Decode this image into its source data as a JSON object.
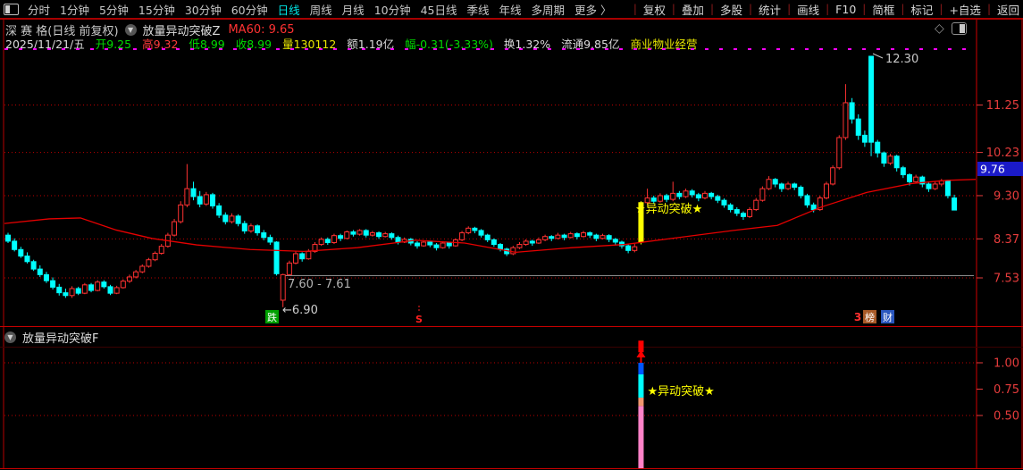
{
  "colors": {
    "background": "#000000",
    "accent_red": "#C80000",
    "menu_text": "#C8C8C8",
    "active_tab": "#00E5E5",
    "candle_up": "#FF3232",
    "candle_down": "#00FFFF",
    "highlight_candle": "#FFFF00",
    "ma60_line": "#E60000",
    "grid_dotted": "#BE0000",
    "axis_text": "#E63C3C",
    "price_box_bg": "#1A1AC8",
    "magenta_line": "#FF00FF",
    "gap_line": "#8C8C8C",
    "fall_badge_bg": "#00A000",
    "rank_badge_bg": "#A85A28",
    "finance_badge_bg": "#2B57BE",
    "bar_pink": "#FF82C8",
    "bar_salmon": "#F0966E",
    "bar_cyan": "#00FFFF",
    "bar_blue": "#0055FF",
    "bar_red": "#FF0000",
    "annotation_gray": "#C8C8C8",
    "yellow_text": "#FFFF00"
  },
  "menu_bar": {
    "left_items": [
      "分时",
      "1分钟",
      "5分钟",
      "15分钟",
      "30分钟",
      "60分钟",
      "日线",
      "周线",
      "月线",
      "10分钟",
      "45日线",
      "季线",
      "年线",
      "多周期",
      "更多 〉"
    ],
    "active_item": "日线",
    "right_items": [
      "复权",
      "叠加",
      "多股",
      "统计",
      "画线",
      "F10",
      "简框",
      "标记",
      "+自选",
      "返回"
    ]
  },
  "title_row": {
    "stock_title": "深 赛 格(日线 前复权)",
    "chevron_glyph": "▼",
    "indicator_name": "放量异动突破Z",
    "ma_label": "MA60: 9.65",
    "diamond_glyph": "◇"
  },
  "info_row": {
    "date": "2025/11/21/五",
    "open": "开9.25",
    "high": "高9.32",
    "low": "低8.99",
    "close": "收8.99",
    "volume": "量130112",
    "amount": "额1.19亿",
    "change": "幅-0.31(-3.33%)",
    "turnover": "换1.32%",
    "float_shares": "流通9.85亿",
    "industry": "商业物业经营"
  },
  "sub_panel": {
    "label": "放量异动突破F"
  },
  "chart_data": [
    {
      "type": "candlestick",
      "title": "深赛格 日线 前复权",
      "y_ticks": [
        "11.25",
        "10.23",
        "9.30",
        "8.37",
        "7.53"
      ],
      "price_box": "9.76",
      "grid": "dotted-red-horizontal",
      "legend_position": "none",
      "annotations": {
        "peak": "12.30",
        "gap_range": "7.60 - 7.61",
        "low": "←6.90",
        "fall_badge": "跌",
        "sell_marker": "S",
        "rank_num": "3",
        "rank_badge": "榜",
        "finance_badge": "财",
        "breakout": "★异动突破★"
      },
      "ma60": {
        "name": "MA60",
        "value": 9.65,
        "points": [
          [
            5,
            8.7
          ],
          [
            55,
            8.8
          ],
          [
            90,
            8.82
          ],
          [
            130,
            8.56
          ],
          [
            170,
            8.38
          ],
          [
            220,
            8.24
          ],
          [
            280,
            8.14
          ],
          [
            340,
            8.1
          ],
          [
            400,
            8.18
          ],
          [
            465,
            8.34
          ],
          [
            520,
            8.28
          ],
          [
            577,
            8.08
          ],
          [
            640,
            8.18
          ],
          [
            700,
            8.25
          ],
          [
            760,
            8.4
          ],
          [
            820,
            8.55
          ],
          [
            870,
            8.66
          ],
          [
            920,
            9.06
          ],
          [
            970,
            9.37
          ],
          [
            1020,
            9.56
          ],
          [
            1060,
            9.63
          ],
          [
            1092,
            9.65
          ]
        ]
      },
      "highlight_index": 99,
      "spike_index": 135,
      "candles": [
        [
          8.45,
          8.5,
          8.28,
          8.32
        ],
        [
          8.32,
          8.38,
          8.1,
          8.14
        ],
        [
          8.14,
          8.2,
          7.96,
          8.0
        ],
        [
          8.0,
          8.08,
          7.84,
          7.88
        ],
        [
          7.88,
          7.92,
          7.68,
          7.72
        ],
        [
          7.72,
          7.8,
          7.55,
          7.6
        ],
        [
          7.6,
          7.66,
          7.42,
          7.47
        ],
        [
          7.47,
          7.54,
          7.28,
          7.33
        ],
        [
          7.33,
          7.4,
          7.15,
          7.21
        ],
        [
          7.21,
          7.3,
          7.1,
          7.15
        ],
        [
          7.15,
          7.35,
          7.1,
          7.3
        ],
        [
          7.3,
          7.34,
          7.16,
          7.2
        ],
        [
          7.2,
          7.42,
          7.18,
          7.38
        ],
        [
          7.38,
          7.42,
          7.22,
          7.26
        ],
        [
          7.26,
          7.48,
          7.24,
          7.44
        ],
        [
          7.44,
          7.48,
          7.3,
          7.34
        ],
        [
          7.34,
          7.38,
          7.16,
          7.2
        ],
        [
          7.2,
          7.36,
          7.18,
          7.32
        ],
        [
          7.32,
          7.5,
          7.3,
          7.46
        ],
        [
          7.46,
          7.6,
          7.42,
          7.55
        ],
        [
          7.55,
          7.7,
          7.52,
          7.66
        ],
        [
          7.66,
          7.82,
          7.63,
          7.78
        ],
        [
          7.78,
          7.96,
          7.75,
          7.92
        ],
        [
          7.92,
          8.1,
          7.89,
          8.06
        ],
        [
          8.06,
          8.26,
          8.03,
          8.21
        ],
        [
          8.21,
          8.5,
          8.18,
          8.45
        ],
        [
          8.45,
          8.8,
          8.42,
          8.74
        ],
        [
          8.74,
          9.18,
          8.7,
          9.1
        ],
        [
          9.1,
          9.98,
          9.05,
          9.45
        ],
        [
          9.45,
          9.6,
          9.2,
          9.28
        ],
        [
          9.28,
          9.4,
          9.05,
          9.12
        ],
        [
          9.12,
          9.38,
          9.08,
          9.32
        ],
        [
          9.32,
          9.36,
          9.02,
          9.08
        ],
        [
          9.08,
          9.14,
          8.82,
          8.88
        ],
        [
          8.88,
          8.94,
          8.68,
          8.74
        ],
        [
          8.74,
          8.92,
          8.7,
          8.86
        ],
        [
          8.86,
          8.9,
          8.64,
          8.7
        ],
        [
          8.7,
          8.76,
          8.48,
          8.54
        ],
        [
          8.54,
          8.7,
          8.5,
          8.65
        ],
        [
          8.65,
          8.68,
          8.44,
          8.5
        ],
        [
          8.5,
          8.56,
          8.34,
          8.4
        ],
        [
          8.4,
          8.46,
          8.24,
          8.3
        ],
        [
          8.3,
          8.32,
          7.58,
          7.62
        ],
        [
          7.05,
          7.62,
          6.9,
          7.6
        ],
        [
          7.6,
          7.9,
          7.58,
          7.85
        ],
        [
          7.85,
          8.1,
          7.82,
          8.05
        ],
        [
          8.05,
          8.08,
          7.88,
          7.94
        ],
        [
          7.94,
          8.15,
          7.92,
          8.1
        ],
        [
          8.1,
          8.3,
          8.07,
          8.25
        ],
        [
          8.25,
          8.4,
          8.22,
          8.36
        ],
        [
          8.36,
          8.4,
          8.24,
          8.29
        ],
        [
          8.29,
          8.48,
          8.26,
          8.44
        ],
        [
          8.44,
          8.48,
          8.32,
          8.38
        ],
        [
          8.38,
          8.55,
          8.36,
          8.52
        ],
        [
          8.52,
          8.56,
          8.42,
          8.47
        ],
        [
          8.47,
          8.58,
          8.44,
          8.55
        ],
        [
          8.55,
          8.58,
          8.4,
          8.45
        ],
        [
          8.45,
          8.54,
          8.42,
          8.5
        ],
        [
          8.5,
          8.53,
          8.37,
          8.42
        ],
        [
          8.42,
          8.52,
          8.4,
          8.48
        ],
        [
          8.48,
          8.51,
          8.35,
          8.4
        ],
        [
          8.4,
          8.44,
          8.25,
          8.3
        ],
        [
          8.3,
          8.4,
          8.28,
          8.36
        ],
        [
          8.36,
          8.39,
          8.23,
          8.28
        ],
        [
          8.28,
          8.32,
          8.16,
          8.22
        ],
        [
          8.22,
          8.34,
          8.2,
          8.3
        ],
        [
          8.3,
          8.33,
          8.19,
          8.24
        ],
        [
          8.24,
          8.28,
          8.12,
          8.18
        ],
        [
          8.18,
          8.32,
          8.16,
          8.28
        ],
        [
          8.28,
          8.31,
          8.16,
          8.22
        ],
        [
          8.22,
          8.38,
          8.2,
          8.35
        ],
        [
          8.35,
          8.54,
          8.32,
          8.5
        ],
        [
          8.5,
          8.64,
          8.47,
          8.6
        ],
        [
          8.6,
          8.63,
          8.49,
          8.55
        ],
        [
          8.55,
          8.58,
          8.4,
          8.45
        ],
        [
          8.45,
          8.48,
          8.3,
          8.35
        ],
        [
          8.35,
          8.38,
          8.2,
          8.25
        ],
        [
          8.25,
          8.28,
          8.1,
          8.15
        ],
        [
          8.15,
          8.18,
          8.0,
          8.05
        ],
        [
          8.05,
          8.22,
          8.02,
          8.18
        ],
        [
          8.18,
          8.3,
          8.15,
          8.25
        ],
        [
          8.25,
          8.36,
          8.22,
          8.32
        ],
        [
          8.32,
          8.35,
          8.22,
          8.28
        ],
        [
          8.28,
          8.4,
          8.26,
          8.35
        ],
        [
          8.35,
          8.46,
          8.32,
          8.42
        ],
        [
          8.42,
          8.45,
          8.32,
          8.38
        ],
        [
          8.38,
          8.5,
          8.36,
          8.45
        ],
        [
          8.45,
          8.48,
          8.34,
          8.4
        ],
        [
          8.4,
          8.52,
          8.38,
          8.48
        ],
        [
          8.48,
          8.51,
          8.36,
          8.42
        ],
        [
          8.42,
          8.54,
          8.4,
          8.5
        ],
        [
          8.5,
          8.53,
          8.39,
          8.45
        ],
        [
          8.45,
          8.48,
          8.32,
          8.38
        ],
        [
          8.38,
          8.48,
          8.36,
          8.44
        ],
        [
          8.44,
          8.47,
          8.3,
          8.36
        ],
        [
          8.36,
          8.39,
          8.24,
          8.3
        ],
        [
          8.3,
          8.33,
          8.16,
          8.22
        ],
        [
          8.22,
          8.25,
          8.06,
          8.12
        ],
        [
          8.12,
          8.26,
          8.08,
          8.2
        ],
        [
          8.3,
          9.18,
          8.25,
          9.15
        ],
        [
          9.15,
          9.45,
          9.1,
          9.25
        ],
        [
          9.25,
          9.3,
          9.12,
          9.18
        ],
        [
          9.18,
          9.35,
          9.15,
          9.3
        ],
        [
          9.3,
          9.34,
          9.16,
          9.22
        ],
        [
          9.22,
          9.6,
          9.18,
          9.35
        ],
        [
          9.35,
          9.4,
          9.22,
          9.28
        ],
        [
          9.28,
          9.45,
          9.25,
          9.4
        ],
        [
          9.4,
          9.44,
          9.26,
          9.32
        ],
        [
          9.32,
          9.36,
          9.18,
          9.25
        ],
        [
          9.25,
          9.4,
          9.22,
          9.35
        ],
        [
          9.35,
          9.38,
          9.22,
          9.28
        ],
        [
          9.28,
          9.32,
          9.14,
          9.2
        ],
        [
          9.2,
          9.24,
          9.04,
          9.1
        ],
        [
          9.1,
          9.14,
          8.94,
          9.0
        ],
        [
          9.0,
          9.05,
          8.86,
          8.92
        ],
        [
          8.92,
          8.96,
          8.78,
          8.85
        ],
        [
          8.85,
          9.05,
          8.82,
          9.0
        ],
        [
          9.0,
          9.25,
          8.97,
          9.2
        ],
        [
          9.2,
          9.5,
          9.17,
          9.45
        ],
        [
          9.45,
          9.72,
          9.42,
          9.65
        ],
        [
          9.65,
          9.68,
          9.48,
          9.55
        ],
        [
          9.55,
          9.58,
          9.38,
          9.45
        ],
        [
          9.45,
          9.6,
          9.42,
          9.55
        ],
        [
          9.55,
          9.58,
          9.42,
          9.48
        ],
        [
          9.48,
          9.52,
          9.24,
          9.3
        ],
        [
          9.3,
          9.34,
          9.04,
          9.1
        ],
        [
          9.1,
          9.15,
          8.94,
          9.0
        ],
        [
          9.0,
          9.3,
          8.97,
          9.25
        ],
        [
          9.25,
          9.6,
          9.22,
          9.55
        ],
        [
          9.55,
          9.95,
          9.52,
          9.9
        ],
        [
          9.9,
          10.6,
          9.86,
          10.55
        ],
        [
          10.55,
          11.7,
          10.5,
          11.3
        ],
        [
          11.3,
          11.4,
          10.85,
          10.95
        ],
        [
          10.95,
          11.05,
          10.5,
          10.6
        ],
        [
          10.6,
          10.7,
          10.35,
          10.45
        ],
        [
          12.3,
          12.3,
          10.15,
          10.45
        ],
        [
          10.45,
          10.5,
          10.12,
          10.22
        ],
        [
          10.22,
          10.25,
          9.92,
          10.0
        ],
        [
          10.0,
          10.2,
          9.96,
          10.15
        ],
        [
          10.15,
          10.18,
          9.82,
          9.9
        ],
        [
          9.9,
          9.94,
          9.68,
          9.75
        ],
        [
          9.75,
          9.78,
          9.52,
          9.6
        ],
        [
          9.6,
          9.75,
          9.56,
          9.7
        ],
        [
          9.7,
          9.73,
          9.48,
          9.55
        ],
        [
          9.55,
          9.58,
          9.38,
          9.45
        ],
        [
          9.45,
          9.6,
          9.42,
          9.55
        ],
        [
          9.55,
          9.66,
          9.5,
          9.62
        ],
        [
          9.62,
          9.64,
          9.24,
          9.3
        ],
        [
          9.25,
          9.32,
          8.99,
          8.99
        ]
      ]
    },
    {
      "type": "bar",
      "title": "放量异动突破F",
      "y_ticks": [
        "1.00",
        "0.75",
        "0.50"
      ],
      "bar": {
        "index": 99,
        "segments": [
          [
            "#FF82C8",
            0,
            0.59
          ],
          [
            "#F0966E",
            0.59,
            0.67
          ],
          [
            "#00FFFF",
            0.67,
            0.89
          ],
          [
            "#0055FF",
            0.89,
            1.0
          ]
        ],
        "arrow_from": 1.0,
        "arrow_to": 1.1,
        "cap": [
          1.1,
          1.21
        ],
        "annotation": "★异动突破★"
      }
    }
  ]
}
